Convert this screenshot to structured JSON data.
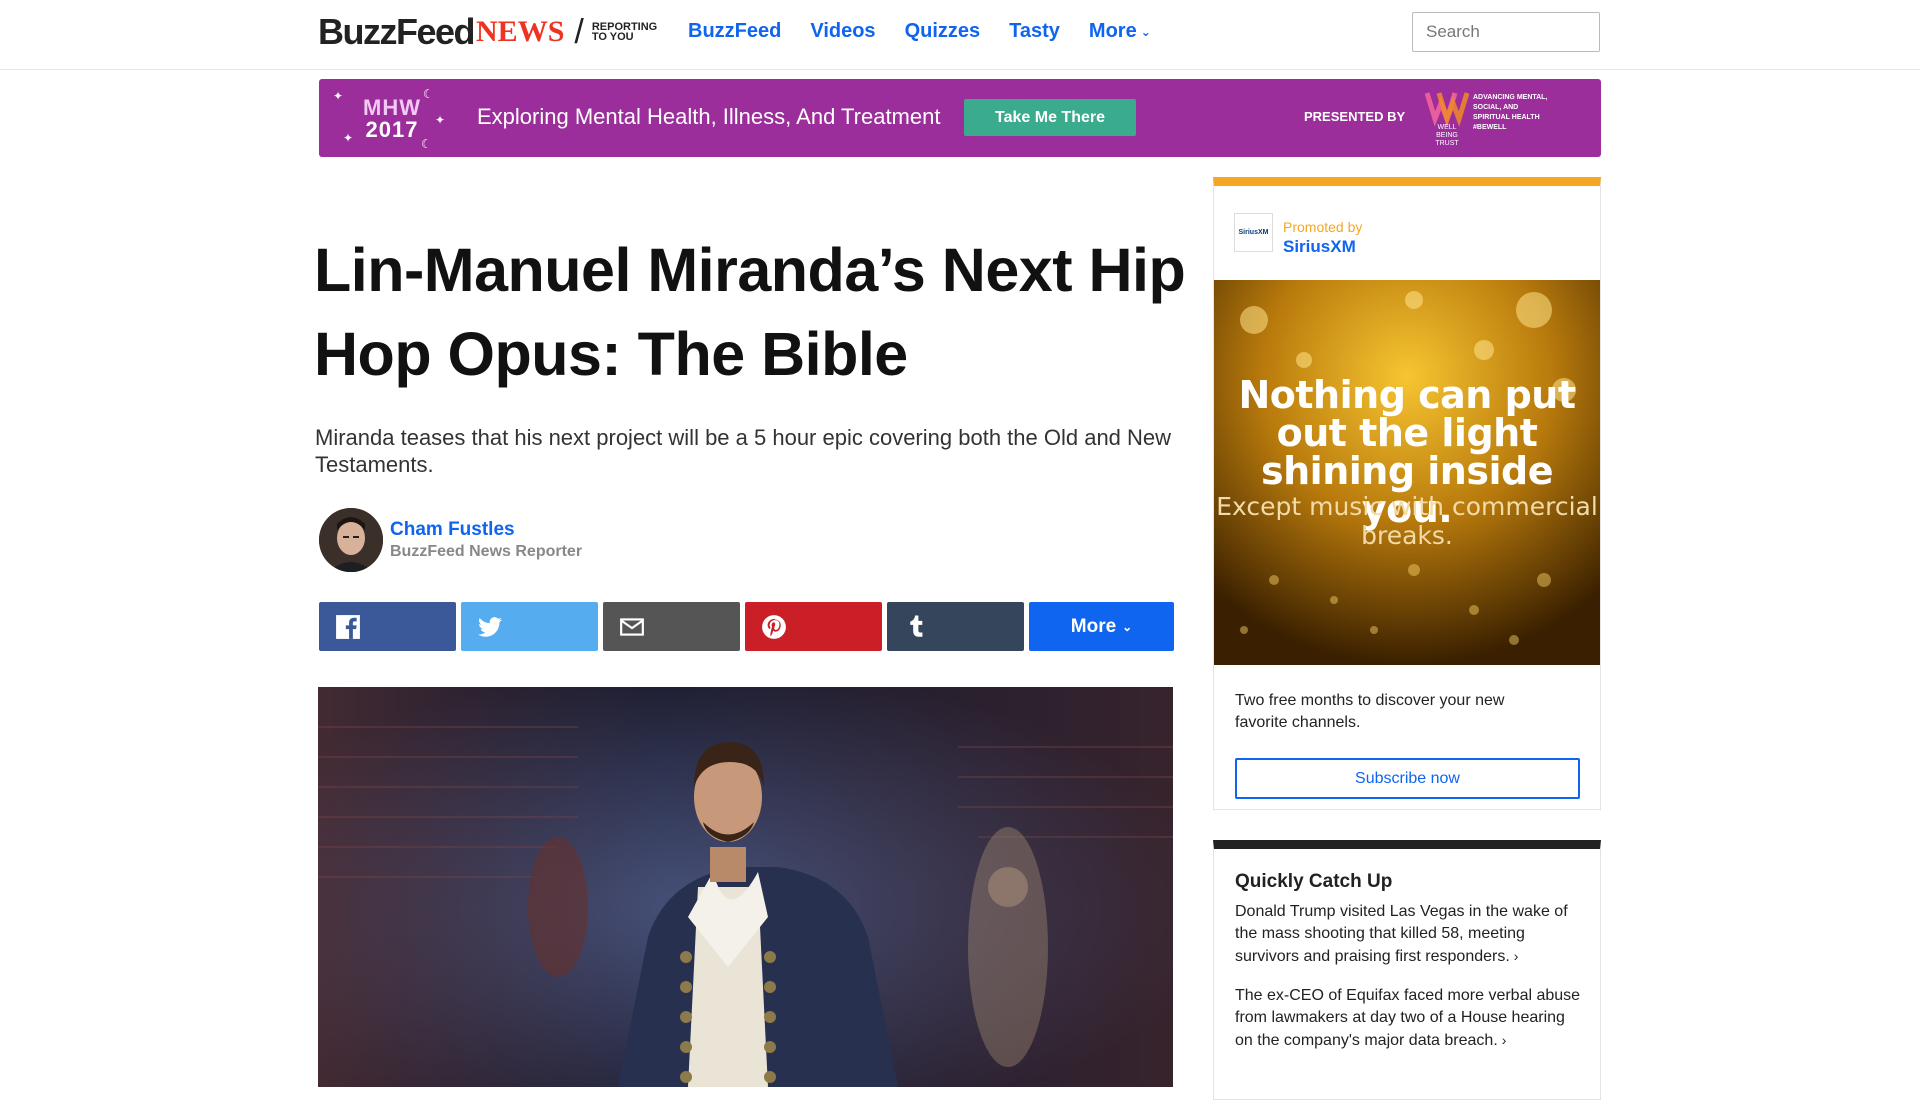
{
  "header": {
    "logo_buzzfeed": "BuzzFeed",
    "logo_news": "NEWS",
    "logo_slash": "/",
    "logo_tagline": "REPORTING TO YOU",
    "nav": [
      {
        "label": "BuzzFeed"
      },
      {
        "label": "Videos"
      },
      {
        "label": "Quizzes"
      },
      {
        "label": "Tasty"
      },
      {
        "label": "More"
      }
    ],
    "search_placeholder": "Search"
  },
  "banner": {
    "badge_top": "MHW",
    "badge_year": "2017",
    "text": "Exploring Mental Health, Illness, And Treatment",
    "button_label": "Take Me There",
    "presented_by": "PRESENTED BY",
    "sponsor_mark_text": "WELL BEING TRUST",
    "sponsor_desc": "ADVANCING MENTAL, SOCIAL, AND SPIRITUAL HEALTH #BeWell",
    "color": "#9c2e9b"
  },
  "article": {
    "headline": "Lin-Manuel Miranda’s Next Hip Hop Opus: The Bible",
    "dek": "Miranda teases that his next project will be a 5 hour epic covering both the Old and New Testaments.",
    "author_name": "Cham Fustles",
    "author_role": "BuzzFeed News Reporter",
    "share_more_label": "More",
    "share_buttons": [
      {
        "icon": "facebook-icon",
        "color": "#3b5998"
      },
      {
        "icon": "twitter-icon",
        "color": "#55acee"
      },
      {
        "icon": "email-icon",
        "color": "#555555"
      },
      {
        "icon": "pinterest-icon",
        "color": "#cb1f27"
      },
      {
        "icon": "tumblr-icon",
        "color": "#35465c"
      }
    ]
  },
  "promo": {
    "logo_text": "SiriusXM",
    "promoted_by": "Promoted by",
    "sponsor": "SiriusXM",
    "image_headline": "Nothing can put out the light shining inside you.",
    "image_sub": "Except music with commercial breaks.",
    "copy": "Two free months to discover your new favorite channels.",
    "button_label": "Subscribe now"
  },
  "catchup": {
    "title": "Quickly Catch Up",
    "items": [
      {
        "text": "Donald Trump visited Las Vegas in the wake of the mass shooting that killed 58, meeting survivors and praising first responders."
      },
      {
        "text": "The ex-CEO of Equifax faced more verbal abuse from lawmakers at day two of a House hearing on the company's major data breach."
      }
    ]
  },
  "colors": {
    "link_blue": "#0f65ef",
    "promo_accent": "#f5a623",
    "banner_button": "#3bab8e"
  }
}
